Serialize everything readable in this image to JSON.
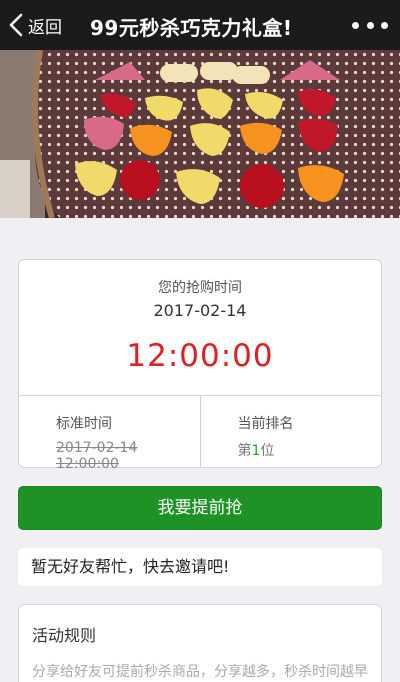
{
  "navbar": {
    "back_label": "返回",
    "title": "99元秒杀巧克力礼盒!"
  },
  "banner": {
    "description_icon": "chocolate-box-photo",
    "colors": {
      "box_dots": "#5c3a3a",
      "red": "#c0182a",
      "yellow": "#f2da6a",
      "orange": "#f5931e",
      "pink": "#d86a88"
    }
  },
  "rush": {
    "label": "您的抢购时间",
    "date": "2017-02-14",
    "time": "12:00:00",
    "standard_label": "标准时间",
    "standard_value": "2017-02-14 12:00:00",
    "rank_label": "当前排名",
    "rank_prefix": "第",
    "rank_number": "1",
    "rank_suffix": "位"
  },
  "actions": {
    "rush_button": "我要提前抢"
  },
  "friends": {
    "message": "暂无好友帮忙，快去邀请吧!"
  },
  "rules": {
    "title": "活动规则",
    "text": "分享给好友可提前秒杀商品，分享越多，秒杀时间越早"
  },
  "colors": {
    "accent_green": "#1f9226",
    "time_red": "#e02020",
    "navbar": "#1b1b1d"
  }
}
